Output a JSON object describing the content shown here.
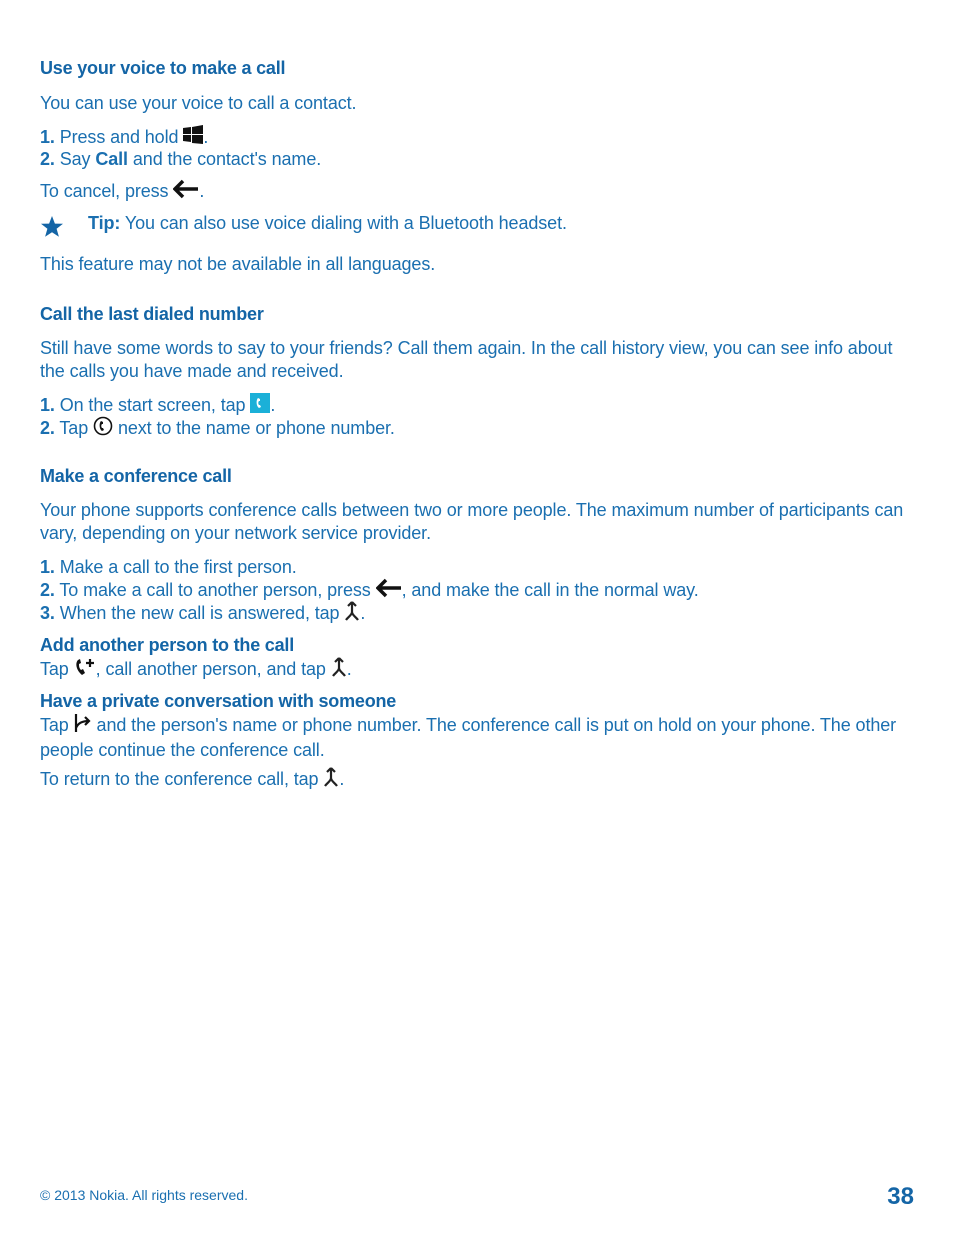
{
  "sections": {
    "voice": {
      "heading": "Use your voice to make a call",
      "intro": "You can use your voice to call a contact.",
      "step1_num": "1.",
      "step1_text": "Press and hold",
      "step2_num": "2.",
      "step2_pre": "Say",
      "step2_bold": "Call",
      "step2_post": "and the contact's name.",
      "cancel_text": "To cancel, press",
      "tip_label": "Tip:",
      "tip_text": "You can also use voice dialing with a Bluetooth headset.",
      "note": "This feature may not be available in all languages.",
      "icons": [
        "windows-key-icon",
        "back-arrow-icon",
        "star-icon"
      ]
    },
    "last_dialed": {
      "heading": "Call the last dialed number",
      "intro": "Still have some words to say to your friends? Call them again. In the call history view, you can see info about the calls you have made and received.",
      "step1_num": "1.",
      "step1_text": "On the start screen, tap",
      "step2_num": "2.",
      "step2_pre": "Tap",
      "step2_post": "next to the name or phone number.",
      "icons": [
        "phone-tile-icon",
        "call-circle-icon"
      ]
    },
    "conference": {
      "heading": "Make a conference call",
      "intro": "Your phone supports conference calls between two or more people. The maximum number of participants can vary, depending on your network service provider.",
      "step1_num": "1.",
      "step1_text": "Make a call to the first person.",
      "step2_num": "2.",
      "step2_pre": "To make a call to another person, press",
      "step2_post": ", and make the call in the normal way.",
      "step3_num": "3.",
      "step3_text": "When the new call is answered, tap",
      "icons": [
        "back-arrow-icon",
        "merge-calls-icon"
      ]
    },
    "add_person": {
      "heading": "Add another person to the call",
      "text_pre": "Tap",
      "text_mid": ", call another person, and tap",
      "icons": [
        "add-call-icon",
        "merge-calls-icon"
      ]
    },
    "private": {
      "heading": "Have a private conversation with someone",
      "text_pre": "Tap",
      "text_post": "and the person's name or phone number. The conference call is put on hold on your phone. The other people continue the conference call.",
      "return_text": "To return to the conference call, tap",
      "icons": [
        "private-call-icon",
        "merge-calls-icon"
      ]
    }
  },
  "footer": {
    "copyright": "© 2013 Nokia. All rights reserved.",
    "page_number": "38"
  },
  "colors": {
    "text": "#1a6fb0",
    "heading": "#1465a6",
    "tile": "#1bb0d8"
  }
}
